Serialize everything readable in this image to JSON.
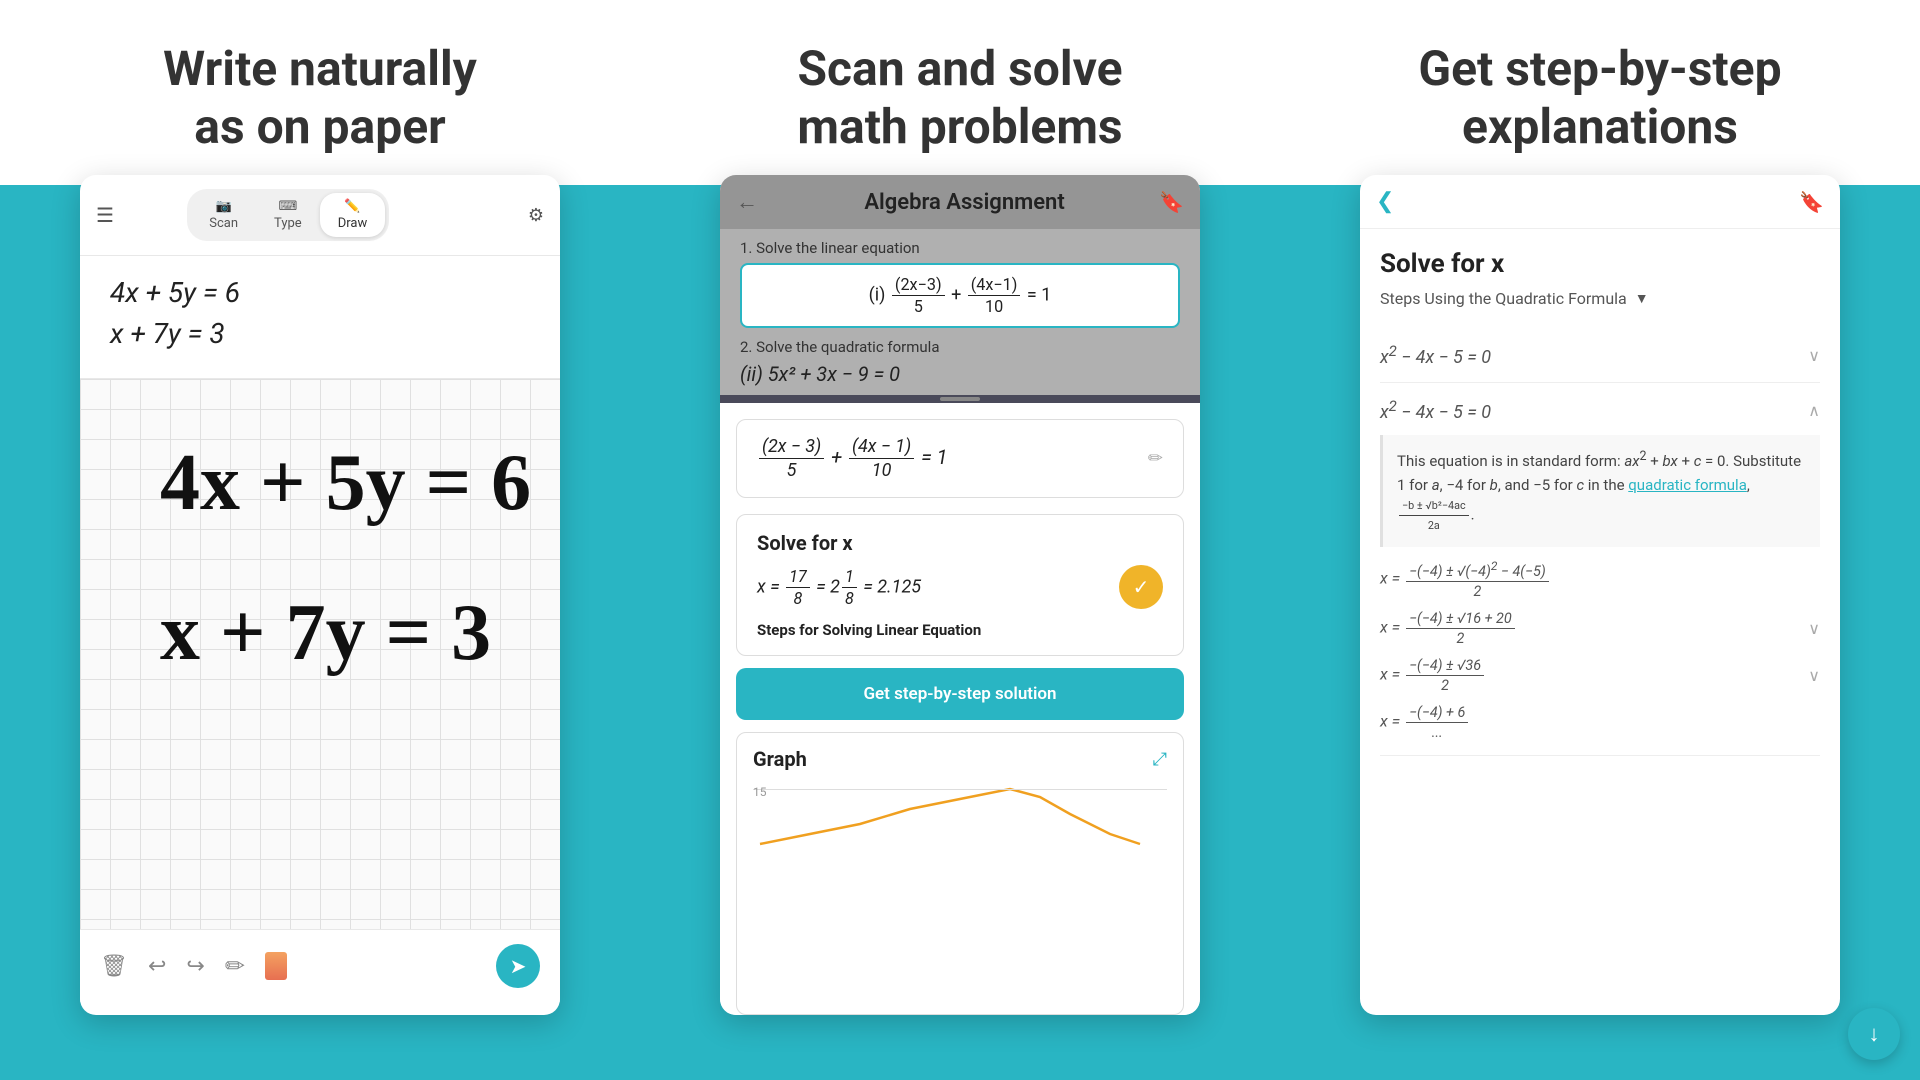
{
  "headings": {
    "col1": "Write naturally\nas on paper",
    "col2": "Scan and solve\nmath problems",
    "col3": "Get step-by-step\nexplanations"
  },
  "left_panel": {
    "toolbar": {
      "scan_label": "Scan",
      "type_label": "Type",
      "draw_label": "Draw"
    },
    "typed_equations": [
      "4x + 5y = 6",
      "x + 7y = 3"
    ],
    "handwritten_equations": [
      "4x + 5y = 6",
      "x + 7y = 3"
    ]
  },
  "mid_panel": {
    "header_title": "Algebra Assignment",
    "problem1_label": "1. Solve the linear equation",
    "problem1_eq": "(2x−3)/5 + (4x−1)/10 = 1",
    "problem2_label": "2. Solve the quadratic formula",
    "problem2_eq": "(ii) 5x² + 3x − 9 = 0",
    "result_eq": "(2x − 3)/5 + (4x − 1)/10 = 1",
    "solve_title": "Solve for x",
    "solve_result": "x = 17/8 = 2 1/8 = 2.125",
    "steps_label": "Steps for Solving Linear Equation",
    "step_btn": "Get step-by-step solution",
    "graph_title": "Graph",
    "graph_number": "15"
  },
  "right_panel": {
    "solve_title": "Solve for x",
    "method_label": "Steps Using the Quadratic Formula",
    "step1_eq": "x² − 4x − 5 = 0",
    "step2_eq": "x² − 4x − 5 = 0",
    "explanation": "This equation is in standard form: ax² + bx + c = 0. Substitute 1 for a, −4 for b, and −5 for c in the quadratic formula, (−b ± √(b²−4ac)) / 2a.",
    "quadratic_formula_link": "quadratic formula",
    "formula1": "x = (−(−4) ± √((−4)² − 4(−5))) / 2",
    "formula2": "x = (−(−4) ± √(16 + 20)) / 2",
    "formula3": "x = (−(−4) ± √36) / 2",
    "formula4": "x = (−(−4) + 6) / ..."
  },
  "colors": {
    "teal": "#29b5c3",
    "yellow": "#f0b429",
    "dark": "#333333",
    "light_gray": "#f0f0f0"
  }
}
